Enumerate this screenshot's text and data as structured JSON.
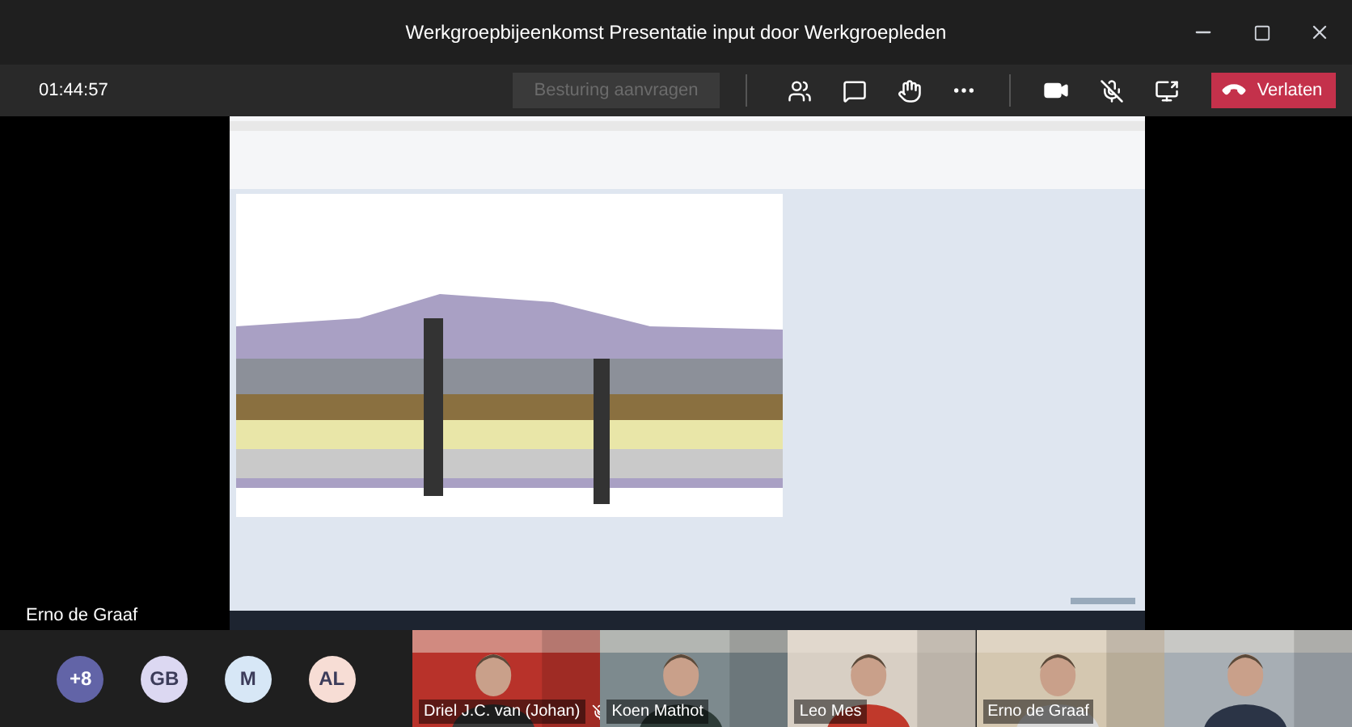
{
  "window": {
    "title": "Werkgroepbijeenkomst Presentatie input door Werkgroepleden"
  },
  "toolbar": {
    "timer": "01:44:57",
    "request_control": {
      "label": "Besturing aanvragen",
      "disabled": true
    },
    "leave_button": {
      "label": "Verlaten"
    }
  },
  "stage": {
    "presenter_name": "Erno de Graaf"
  },
  "avatars": [
    {
      "initials": "+8",
      "color": "#6264a7"
    },
    {
      "initials": "GB",
      "color": "#dcd8f2"
    },
    {
      "initials": "M",
      "color": "#d7e7f6"
    },
    {
      "initials": "AL",
      "color": "#f7ddd5"
    }
  ],
  "participants": [
    {
      "name": "Driel J.C. van (Johan)",
      "muted": true
    },
    {
      "name": "Koen Mathot",
      "muted": false
    },
    {
      "name": "Leo Mes",
      "muted": false
    },
    {
      "name": "Erno de Graaf",
      "muted": false
    },
    {
      "muted": false
    }
  ]
}
